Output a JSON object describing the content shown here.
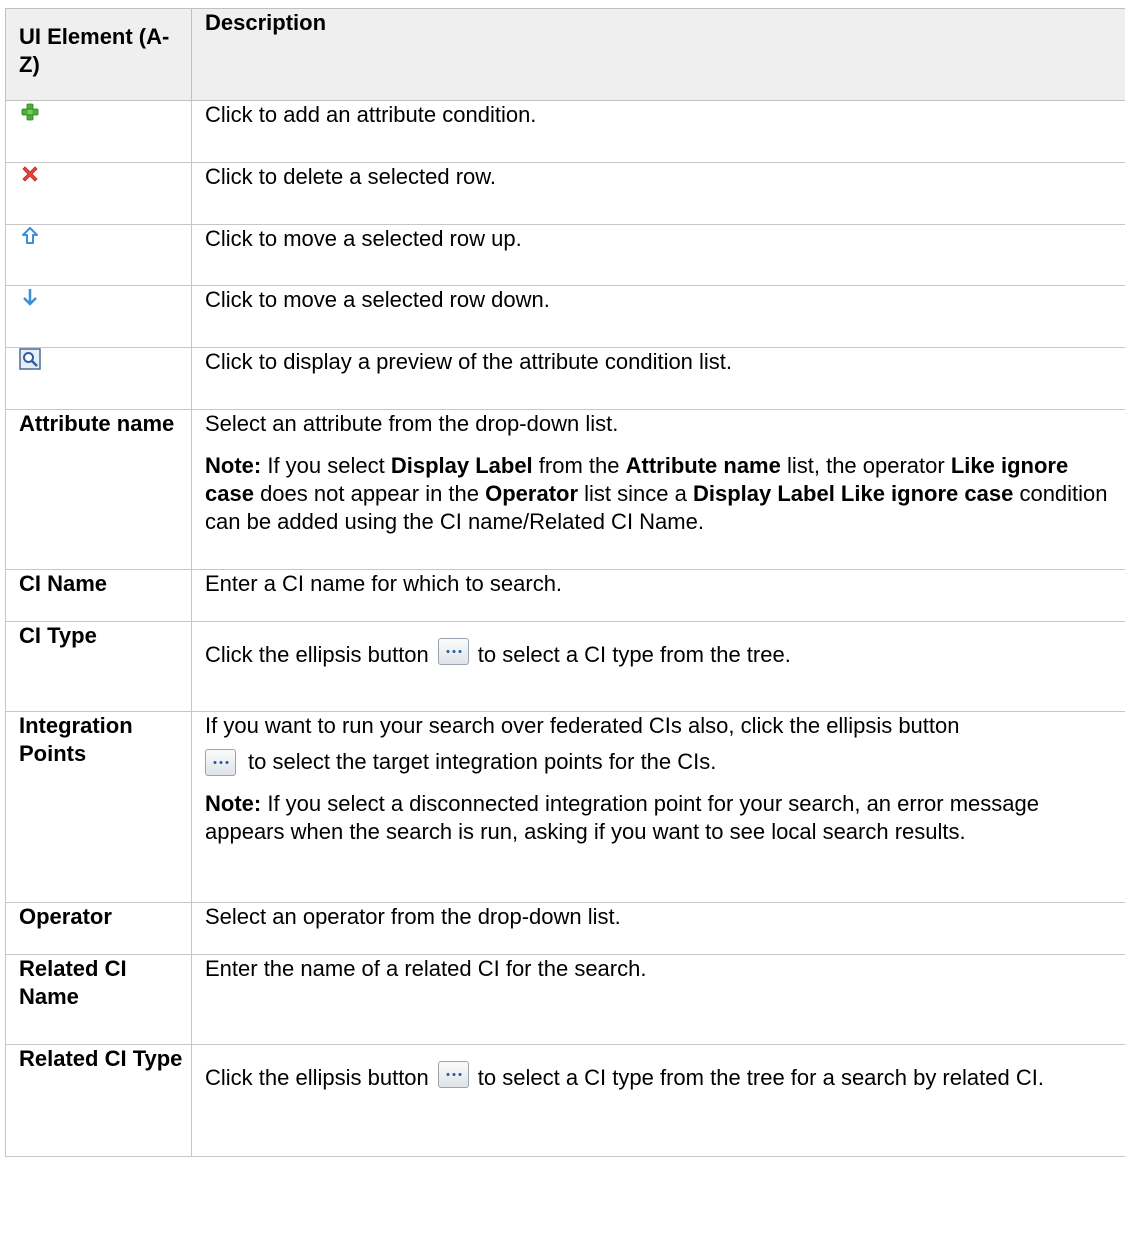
{
  "header": {
    "col1": "UI Element (A-Z)",
    "col2": "Description"
  },
  "icon_rows": [
    {
      "icon": "add-icon",
      "description": "Click to add an attribute condition."
    },
    {
      "icon": "delete-icon",
      "description": "Click to delete a selected row."
    },
    {
      "icon": "move-up-icon",
      "description": "Click to move a selected row up."
    },
    {
      "icon": "move-down-icon",
      "description": "Click to move a selected row down."
    },
    {
      "icon": "preview-icon",
      "description": "Click to display a preview of the attribute condition list."
    }
  ],
  "rows": {
    "attribute_name": {
      "name": "Attribute name",
      "text": "Select an attribute from the drop-down list.",
      "note_label": "Note:",
      "note_1": " If you select ",
      "note_b1": "Display Label",
      "note_2": " from the ",
      "note_b2": "Attribute name",
      "note_3": " list, the operator ",
      "note_b3": "Like ignore case",
      "note_4": " does not appear in the ",
      "note_b4": "Operator",
      "note_5": " list since a ",
      "note_b5": "Display Label Like ignore case",
      "note_6": " condition can be added using the CI name/Related CI Name."
    },
    "ci_name": {
      "name": "CI Name",
      "text": "Enter a CI name for which to search."
    },
    "ci_type": {
      "name": "CI Type",
      "text_before": "Click the ellipsis button",
      "text_after": "to select a CI type from the tree."
    },
    "integration_points": {
      "name": "Integration Points",
      "text_line1": "If you want to run your search over federated CIs also, click the ellipsis button",
      "text_after": "to select the target integration points for the CIs.",
      "note_label": "Note:",
      "note_text": " If you select a disconnected integration point for your search, an error message appears when the search is run, asking if you want to see local search results."
    },
    "operator": {
      "name": "Operator",
      "text": "Select an operator from the drop-down list."
    },
    "related_ci_name": {
      "name": "Related CI Name",
      "text": "Enter the name of a related CI for the search."
    },
    "related_ci_type": {
      "name": "Related CI Type",
      "text_before": "Click the ellipsis button",
      "text_after": "to select a CI type from the tree for a search by related CI."
    }
  },
  "colors": {
    "header_bg": "#efefef",
    "border": "#c6c6c6",
    "add_green": "#4caf3a",
    "delete_red": "#e8463c",
    "arrow_blue": "#3a8fd8"
  }
}
